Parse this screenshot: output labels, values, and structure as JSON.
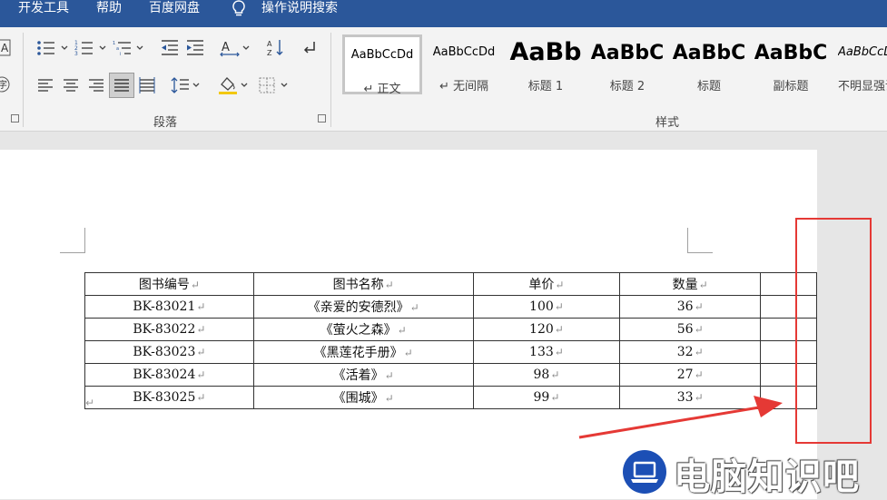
{
  "menu": {
    "items": [
      "开发工具",
      "帮助",
      "百度网盘",
      "操作说明搜索"
    ]
  },
  "ribbon": {
    "groups": {
      "paragraph": "段落",
      "styles": "样式"
    },
    "styles": [
      {
        "preview": "AaBbCcDd",
        "name": "↵ 正文"
      },
      {
        "preview": "AaBbCcDd",
        "name": "↵ 无间隔"
      },
      {
        "preview": "AaBb",
        "name": "标题 1"
      },
      {
        "preview": "AaBbC",
        "name": "标题 2"
      },
      {
        "preview": "AaBbC",
        "name": "标题"
      },
      {
        "preview": "AaBbC",
        "name": "副标题"
      },
      {
        "preview": "AaBbCcDd",
        "name": "不明显强调"
      }
    ]
  },
  "table": {
    "headers": [
      "图书编号",
      "图书名称",
      "单价",
      "数量",
      ""
    ],
    "rows": [
      [
        "BK-83021",
        "《亲爱的安德烈》",
        "100",
        "36",
        ""
      ],
      [
        "BK-83022",
        "《萤火之森》",
        "120",
        "56",
        ""
      ],
      [
        "BK-83023",
        "《黑莲花手册》",
        "133",
        "32",
        ""
      ],
      [
        "BK-83024",
        "《活着》",
        "98",
        "27",
        ""
      ],
      [
        "BK-83025",
        "《围城》",
        "99",
        "33",
        ""
      ]
    ],
    "cell_mark": "↵"
  },
  "document": {
    "paragraph_mark": "↵"
  },
  "watermark": {
    "text": "电脑知识吧"
  },
  "colors": {
    "menubar": "#2b579a",
    "highlight_box": "#e53935",
    "arrow": "#e53935",
    "logo": "#1c4fb5"
  }
}
